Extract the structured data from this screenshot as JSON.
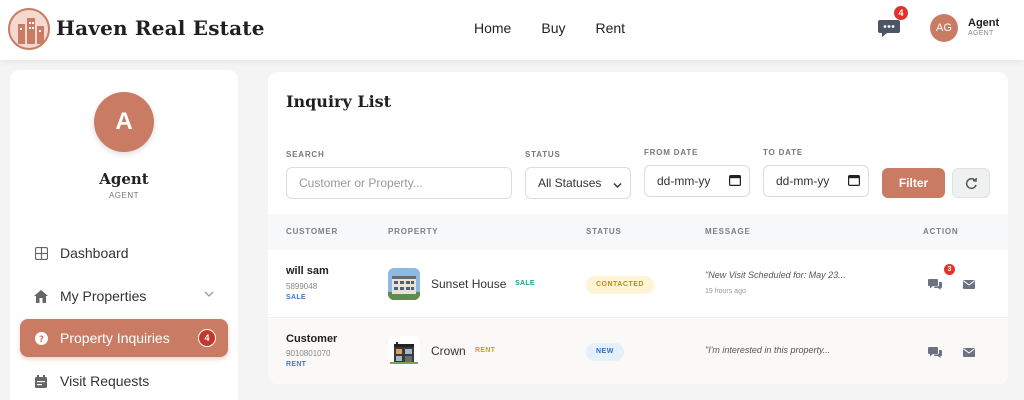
{
  "header": {
    "brand": "Haven Real Estate",
    "nav": [
      "Home",
      "Buy",
      "Rent"
    ],
    "chat_badge": "4",
    "user_initials": "AG",
    "user_name": "Agent",
    "user_role": "AGENT"
  },
  "sidebar": {
    "avatar_letter": "A",
    "name": "Agent",
    "role": "AGENT",
    "items": [
      {
        "label": "Dashboard",
        "icon": "grid-icon"
      },
      {
        "label": "My Properties",
        "icon": "house-icon"
      },
      {
        "label": "Property Inquiries",
        "icon": "question-icon",
        "badge": "4"
      },
      {
        "label": "Visit Requests",
        "icon": "calendar-icon"
      }
    ]
  },
  "main": {
    "title": "Inquiry List",
    "filters": {
      "search_label": "SEARCH",
      "search_placeholder": "Customer or Property...",
      "status_label": "STATUS",
      "status_value": "All Statuses",
      "from_label": "FROM DATE",
      "from_value": "dd-mm-yy",
      "to_label": "TO DATE",
      "to_value": "dd-mm-yy",
      "filter_button": "Filter"
    },
    "columns": [
      "CUSTOMER",
      "PROPERTY",
      "STATUS",
      "MESSAGE",
      "ACTION"
    ],
    "rows": [
      {
        "customer": "will sam",
        "phone": "5899048",
        "type": "SALE",
        "property": "Sunset House",
        "property_tag": "SALE",
        "status": "CONTACTED",
        "message": "\"New Visit Scheduled for: May 23...",
        "time": "19 hours ago",
        "chat_badge": "3"
      },
      {
        "customer": "Customer",
        "phone": "9010801070",
        "type": "RENT",
        "property": "Crown",
        "property_tag": "RENT",
        "status": "NEW",
        "message": "\"I'm interested in this property..."
      }
    ]
  },
  "colors": {
    "accent": "#c97b63",
    "badge_red": "#e0342a",
    "sale_tag": "#19a38a",
    "rent_tag": "#d99a1a",
    "contacted_bg": "#fff5d6",
    "contacted_text": "#c48a14",
    "new_bg": "#e6f0fb",
    "new_text": "#2c6fc2"
  }
}
